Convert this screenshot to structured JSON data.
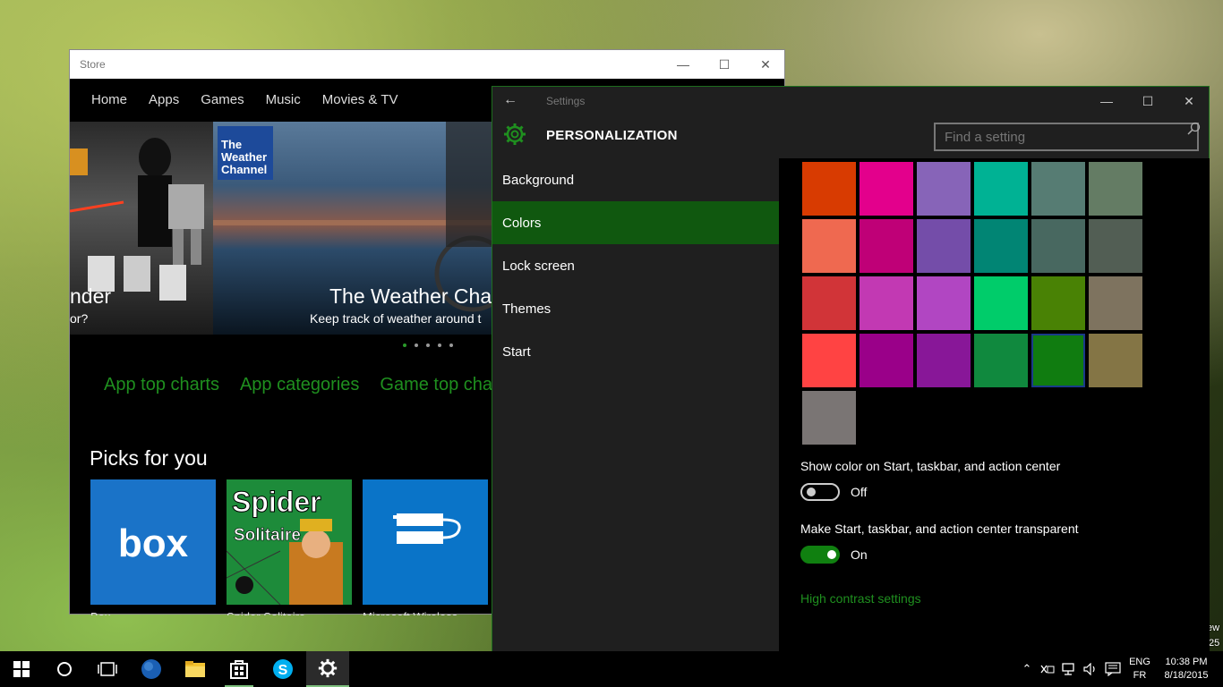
{
  "desktop": {
    "edge_text_1": "ew",
    "edge_text_2": "25"
  },
  "store": {
    "title": "Store",
    "nav": [
      "Home",
      "Apps",
      "Games",
      "Music",
      "Movies & TV"
    ],
    "hero": {
      "logo_text": "The Weather Channel",
      "left_title": "nder",
      "left_sub": "or?",
      "title": "The Weather Char",
      "subtitle": "Keep track of weather around t"
    },
    "links": [
      "App top charts",
      "App categories",
      "Game top cha"
    ],
    "picks_title": "Picks for you",
    "tiles": [
      {
        "logo": "box",
        "label": "Box",
        "color": "#1a73c8"
      },
      {
        "logo": "Spider Solitaire",
        "label": "Spider Solitaire",
        "color": "#1d8b3a"
      },
      {
        "logo": "usb",
        "label": "Microsoft Wireless",
        "color": "#0a74c8"
      }
    ]
  },
  "settings": {
    "title": "Settings",
    "heading": "PERSONALIZATION",
    "search_placeholder": "Find a setting",
    "sidebar": [
      {
        "label": "Background",
        "selected": false
      },
      {
        "label": "Colors",
        "selected": true
      },
      {
        "label": "Lock screen",
        "selected": false
      },
      {
        "label": "Themes",
        "selected": false
      },
      {
        "label": "Start",
        "selected": false
      }
    ],
    "swatches": [
      [
        "#d83b01",
        "#e3008c",
        "#8764b8",
        "#00b294",
        "#567c73",
        "#647c64"
      ],
      [
        "#ef6950",
        "#bf0077",
        "#744da9",
        "#018574",
        "#486860",
        "#525e54"
      ],
      [
        "#d13438",
        "#c239b3",
        "#b146c2",
        "#00cc6a",
        "#498205",
        "#7e735f"
      ],
      [
        "#ff4343",
        "#9a0089",
        "#881798",
        "#10893e",
        "#107c10",
        "#847545"
      ],
      [
        "#7a7574"
      ]
    ],
    "selected_swatch": "#107c10",
    "show_color_label": "Show color on Start, taskbar, and action center",
    "show_color_state": "Off",
    "transparent_label": "Make Start, taskbar, and action center transparent",
    "transparent_state": "On",
    "high_contrast_link": "High contrast settings",
    "accent": "#1f8f1f"
  },
  "taskbar": {
    "lang_1": "ENG",
    "lang_2": "FR",
    "time": "10:38 PM",
    "date": "8/18/2015"
  }
}
